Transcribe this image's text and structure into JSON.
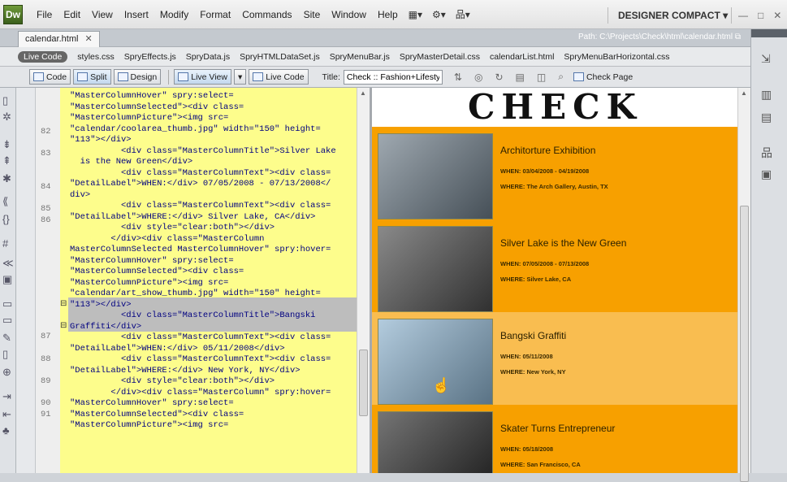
{
  "app": {
    "logo": "Dw",
    "menu": [
      "File",
      "Edit",
      "View",
      "Insert",
      "Modify",
      "Format",
      "Commands",
      "Site",
      "Window",
      "Help"
    ],
    "workspace": "DESIGNER COMPACT",
    "workspace_arrow": "▾"
  },
  "document": {
    "tab_label": "calendar.html",
    "path": "Path:  C:\\Projects\\Check\\html\\calendar.html"
  },
  "related_files": {
    "live_code_label": "Live Code",
    "files": [
      "styles.css",
      "SpryEffects.js",
      "SpryData.js",
      "SpryHTMLDataSet.js",
      "SpryMenuBar.js",
      "SpryMasterDetail.css",
      "calendarList.html",
      "SpryMenuBarHorizontal.css"
    ]
  },
  "doc_toolbar": {
    "code": "Code",
    "split": "Split",
    "design": "Design",
    "live_view": "Live View",
    "live_code": "Live Code",
    "title_label": "Title:",
    "title_value": "Check :: Fashion+Lifestyle",
    "check_page": "Check Page"
  },
  "code_view": {
    "line_numbers": [
      {
        "n": "82",
        "row": 4
      },
      {
        "n": "83",
        "row": 6
      },
      {
        "n": "84",
        "row": 9
      },
      {
        "n": "85",
        "row": 11
      },
      {
        "n": "86",
        "row": 12
      },
      {
        "n": "87",
        "row": 18
      },
      {
        "n": "88",
        "row": 20
      },
      {
        "n": "89",
        "row": 22
      },
      {
        "n": "90",
        "row": 24
      },
      {
        "n": "91",
        "row": 25
      }
    ],
    "lines": [
      "\"MasterColumnHover\" spry:select=",
      "\"MasterColumnSelected\"><div class=",
      "\"MasterColumnPicture\"><img src=",
      "\"calendar/coolarea_thumb.jpg\" width=\"150\" height=",
      "\"113\"></div>",
      "          <div class=\"MasterColumnTitle\">Silver Lake",
      "  is the New Green</div>",
      "          <div class=\"MasterColumnText\"><div class=",
      "\"DetailLabel\">WHEN:</div> 07/05/2008 - 07/13/2008</",
      "div>",
      "          <div class=\"MasterColumnText\"><div class=",
      "\"DetailLabel\">WHERE:</div> Silver Lake, CA</div>",
      "          <div style=\"clear:both\"></div>",
      "        </div><div class=\"MasterColumn",
      "MasterColumnSelected MasterColumnHover\" spry:hover=",
      "\"MasterColumnHover\" spry:select=",
      "\"MasterColumnSelected\"><div class=",
      "\"MasterColumnPicture\"><img src=",
      "\"calendar/art_show_thumb.jpg\" width=\"150\" height=",
      "\"113\"></div>",
      "          <div class=\"MasterColumnTitle\">Bangski",
      "Graffiti</div>",
      "          <div class=\"MasterColumnText\"><div class=",
      "\"DetailLabel\">WHEN:</div> 05/11/2008</div>",
      "          <div class=\"MasterColumnText\"><div class=",
      "\"DetailLabel\">WHERE:</div> New York, NY</div>",
      "          <div style=\"clear:both\"></div>",
      "        </div><div class=\"MasterColumn\" spry:hover=",
      "\"MasterColumnHover\" spry:select=",
      "\"MasterColumnSelected\"><div class=",
      "\"MasterColumnPicture\"><img src="
    ]
  },
  "design_view": {
    "brand": "CHECK",
    "items": [
      {
        "title": "Architorture Exhibition",
        "when": "WHEN: 03/04/2008 - 04/19/2008",
        "where": "WHERE: The Arch Gallery, Austin, TX",
        "thumb_color": "#6b7a86",
        "hover": false
      },
      {
        "title": "Silver Lake is the New Green",
        "when": "WHEN: 07/05/2008 - 07/13/2008",
        "where": "WHERE: Silver Lake, CA",
        "thumb_color": "#4a4a4a",
        "hover": false
      },
      {
        "title": "Bangski Graffiti",
        "when": "WHEN: 05/11/2008",
        "where": "WHERE: New York, NY",
        "thumb_color": "#8ab0cc",
        "hover": true
      },
      {
        "title": "Skater Turns Entrepreneur",
        "when": "WHEN: 05/18/2008",
        "where": "WHERE: San Francisco, CA",
        "thumb_color": "#2a2a2a",
        "hover": false
      }
    ]
  },
  "colors": {
    "code_background": "#fdfd8c",
    "design_orange": "#f7a000",
    "hover_orange": "#f9bd50"
  }
}
